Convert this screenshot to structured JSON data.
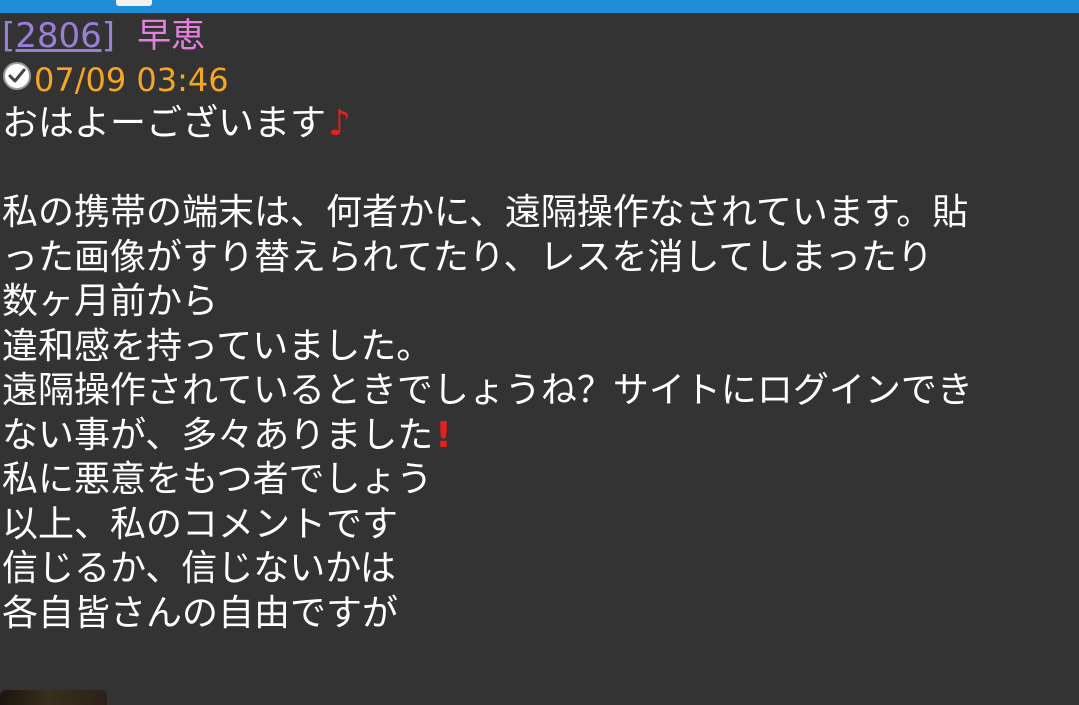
{
  "post": {
    "number": "[2806]",
    "name": "早恵",
    "timestamp": "07/09 03:46",
    "greeting": "おはよーございます",
    "lines": [
      "私の携帯の端末は、何者かに、遠隔操作なされています。貼",
      "った画像がすり替えられてたり、レスを消してしまったり",
      "数ヶ月前から",
      "違和感を持っていました。",
      "遠隔操作されているときでしょうね？サイトにログインでき"
    ],
    "exclaim_line": "ない事が、多々ありました",
    "lines_after": [
      "私に悪意をもつ者でしょう",
      "以上、私のコメントです",
      "信じるか、信じないかは",
      "各自皆さんの自由ですが"
    ],
    "icons": {
      "clock": "clock-icon",
      "note": "music-note-icon",
      "exclamation": "exclamation-icon"
    }
  },
  "colors": {
    "background": "#333333",
    "top_bar": "#1e8fd6",
    "post_number": "#9a7fd6",
    "name": "#e57fe0",
    "timestamp": "#f5a623",
    "text": "#ffffff",
    "emoji_red": "#e8201a"
  }
}
